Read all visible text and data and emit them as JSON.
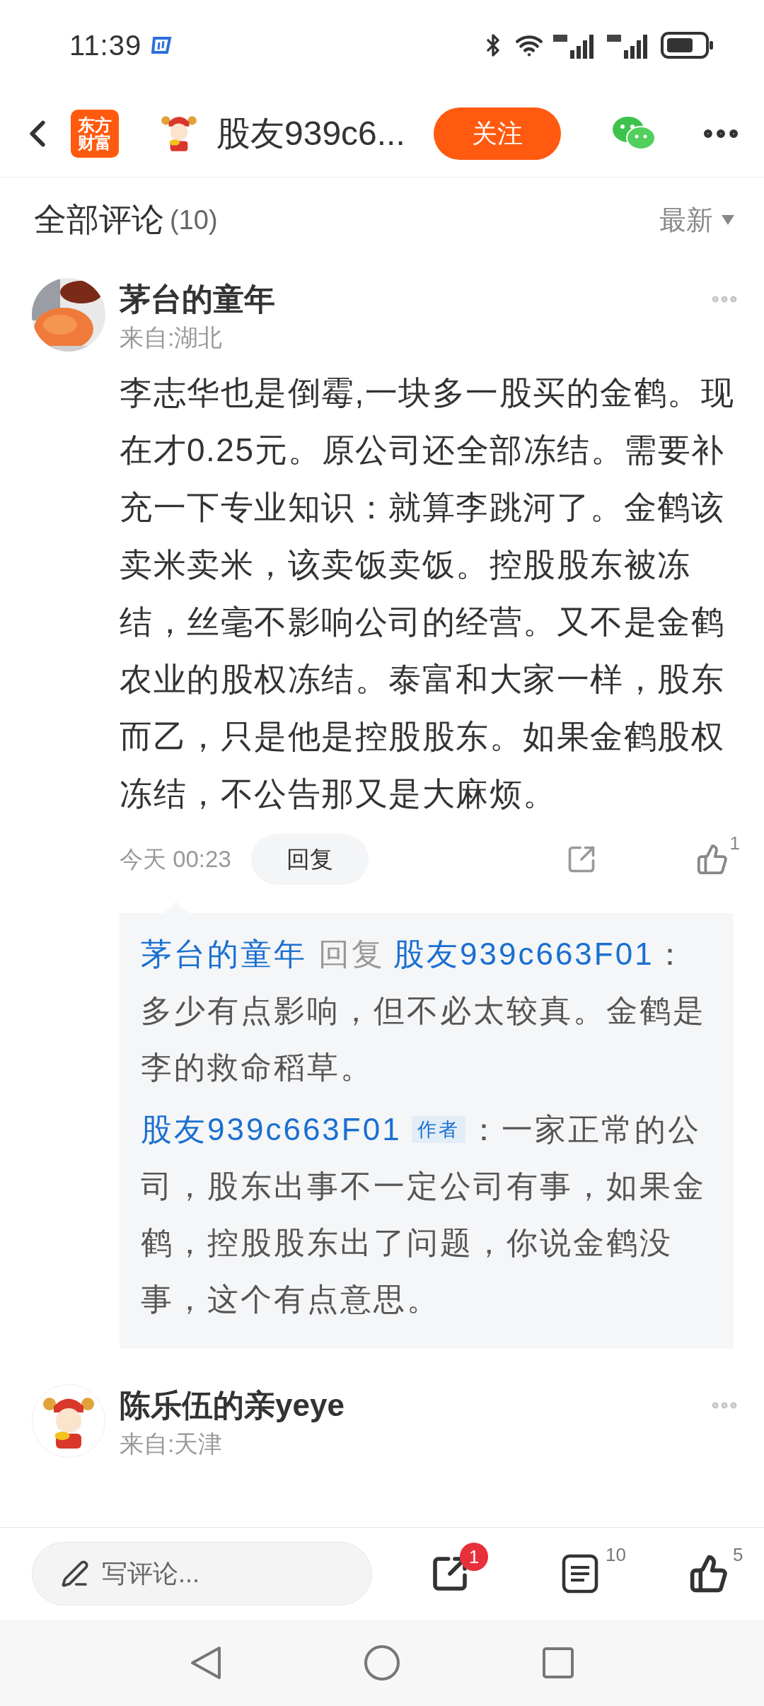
{
  "status_bar": {
    "time": "11:39"
  },
  "header": {
    "logo_lines": [
      "东方",
      "财富"
    ],
    "title": "股友939c6...",
    "follow_button": "关注"
  },
  "comments_header": {
    "title": "全部评论",
    "count": "(10)",
    "sort": "最新"
  },
  "comments": [
    {
      "name": "茅台的童年",
      "location": "来自:湖北",
      "body": "李志华也是倒霉,一块多一股买的金鹤。现在才0.25元。原公司还全部冻结。需要补充一下专业知识：就算李跳河了。金鹤该卖米卖米，该卖饭卖饭。控股股东被冻结，丝毫不影响公司的经营。又不是金鹤农业的股权冻结。泰富和大家一样，股东而乙，只是他是控股股东。如果金鹤股权冻结，不公告那又是大麻烦。",
      "time": "今天 00:23",
      "reply_button": "回复",
      "likes": "1",
      "replies": [
        {
          "author": "茅台的童年",
          "reply_word": "回复",
          "target": "股友939c663F01",
          "text": "：多少有点影响，但不必太较真。金鹤是李的救命稻草。"
        },
        {
          "author": "股友939c663F01",
          "badge": "作者",
          "text": "：一家正常的公司，股东出事不一定公司有事，如果金鹤，控股股东出了问题，你说金鹤没事，这个有点意思。"
        }
      ]
    },
    {
      "avatar": {
        "kind": "icon"
      },
      "name": "陈乐伍的亲yeye",
      "location": "来自:天津"
    }
  ],
  "bottom_bar": {
    "comment_placeholder": "写评论...",
    "share_badge": "1",
    "comments_count": "10",
    "likes_count": "5"
  }
}
